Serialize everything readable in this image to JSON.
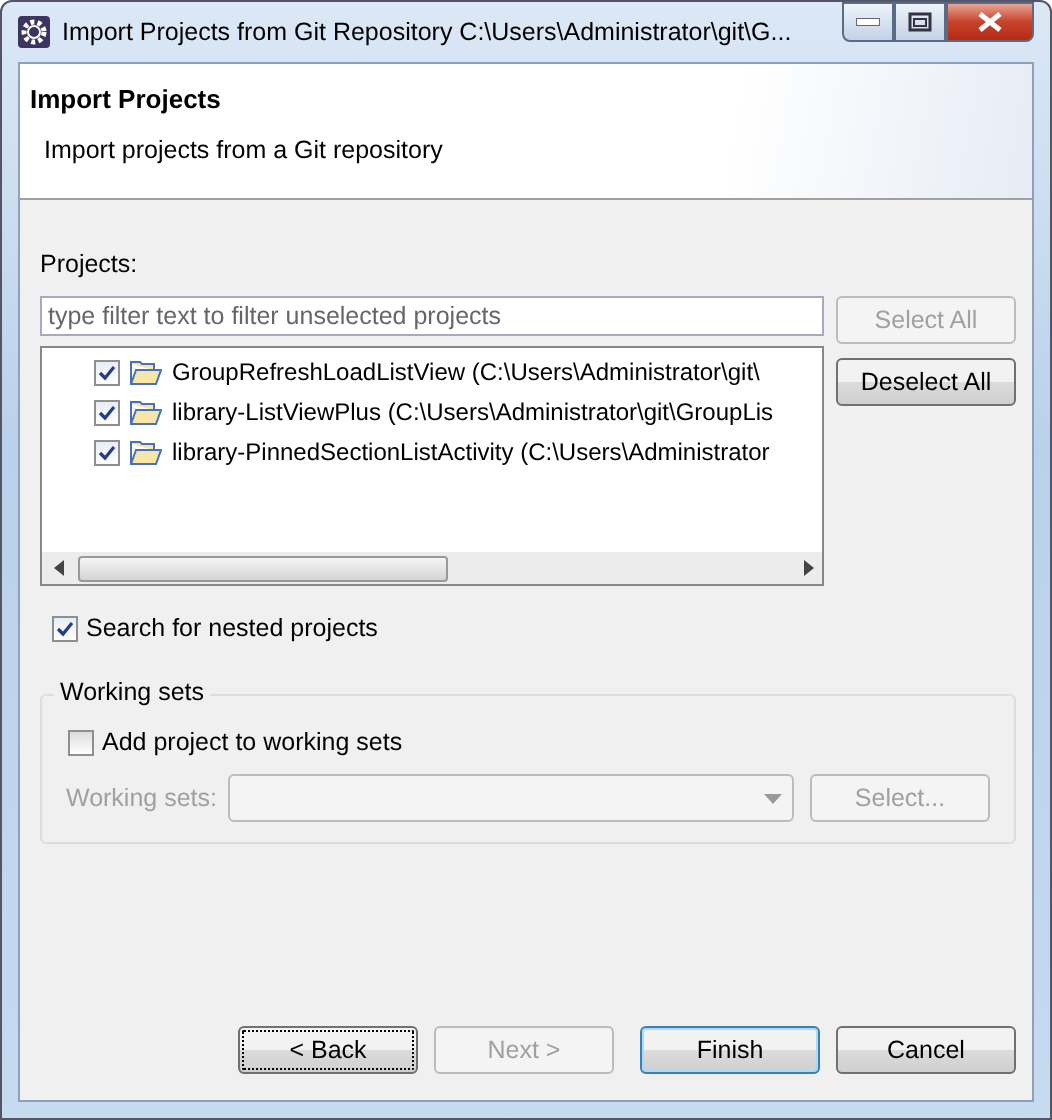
{
  "window": {
    "title": "Import Projects from Git Repository C:\\Users\\Administrator\\git\\G..."
  },
  "header": {
    "title": "Import Projects",
    "description": "Import projects from a Git repository"
  },
  "projects": {
    "label": "Projects:",
    "filter": {
      "placeholder": "type filter text to filter unselected projects"
    },
    "items": [
      {
        "name": "GroupRefreshLoadListView (C:\\Users\\Administrator\\git\\",
        "checked": true
      },
      {
        "name": "library-ListViewPlus (C:\\Users\\Administrator\\git\\GroupLis",
        "checked": true
      },
      {
        "name": "library-PinnedSectionListActivity (C:\\Users\\Administrator",
        "checked": true
      }
    ],
    "buttons": [
      {
        "label": "Select All",
        "disabled": true
      },
      {
        "label": "Deselect All",
        "disabled": false
      }
    ]
  },
  "search_nested": {
    "label": "Search for nested projects",
    "checked": true
  },
  "working_sets": {
    "title": "Working sets",
    "add": {
      "label": "Add project to working sets",
      "checked": false
    },
    "field_label": "Working sets:",
    "select_button": "Select...",
    "disabled": true
  },
  "footer_buttons": [
    {
      "label": "< Back",
      "disabled": false,
      "focused": true
    },
    {
      "label": "Next >",
      "disabled": true,
      "focused": false
    },
    {
      "label": "Finish",
      "disabled": false,
      "focused": false,
      "default": true
    },
    {
      "label": "Cancel",
      "disabled": false,
      "focused": false
    }
  ]
}
